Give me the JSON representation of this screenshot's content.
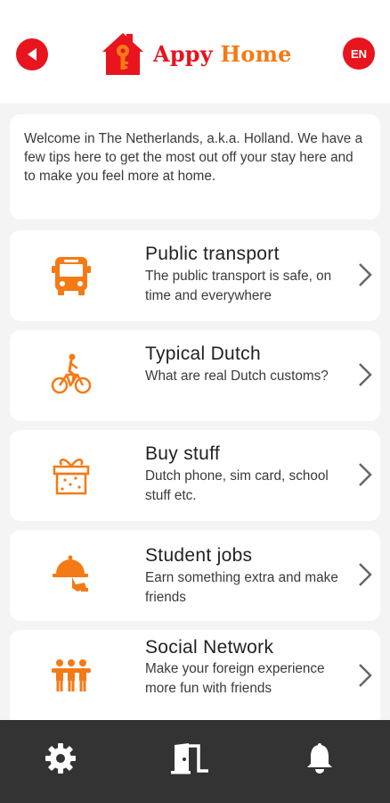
{
  "header": {
    "logo_word1": "Appy",
    "logo_word2": "Home",
    "language": "EN",
    "back_icon": "back-arrow-icon"
  },
  "intro": {
    "text": "Welcome in The Netherlands, a.k.a. Holland. We have a few tips here to get the most out off your stay here and to make you feel more at home."
  },
  "cards": [
    {
      "title": "Public transport",
      "desc": "The public transport is safe, on time and everywhere",
      "icon": "bus-icon"
    },
    {
      "title": "Typical Dutch",
      "desc": "What are real Dutch customs?",
      "icon": "cyclist-icon"
    },
    {
      "title": "Buy stuff",
      "desc": "Dutch phone, sim card, school stuff etc.",
      "icon": "gift-box-icon"
    },
    {
      "title": "Student jobs",
      "desc": "Earn something extra and make friends",
      "icon": "serving-tray-icon"
    },
    {
      "title": "Social Network",
      "desc": "Make your foreign experience more fun with friends",
      "icon": "people-group-icon"
    }
  ],
  "bottom_nav": [
    {
      "icon": "gear-icon"
    },
    {
      "icon": "door-exit-icon"
    },
    {
      "icon": "bell-icon"
    }
  ],
  "colors": {
    "brand_red": "#e8141e",
    "brand_orange": "#f47a16",
    "nav_bar": "#333333",
    "background": "#f4f4f4"
  }
}
